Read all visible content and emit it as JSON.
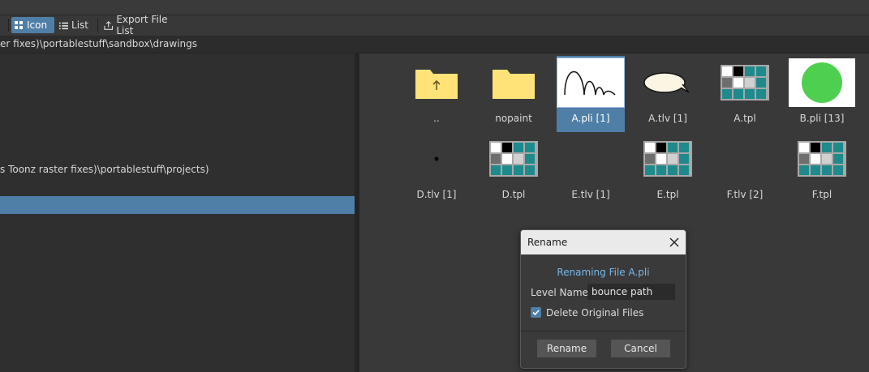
{
  "toolbar": {
    "icon_view_label": "Icon",
    "list_view_label": "List",
    "export_label": "Export File List"
  },
  "pathbar": {
    "path": "er fixes)\\portablestuff\\sandbox\\drawings"
  },
  "tree": {
    "project_path": "s Toonz raster fixes)\\portablestuff\\projects)"
  },
  "files": [
    {
      "label": "..",
      "kind": "folder-up",
      "selected": false
    },
    {
      "label": "nopaint",
      "kind": "folder",
      "selected": false
    },
    {
      "label": "A.pli [1]",
      "kind": "vector-curve",
      "selected": true
    },
    {
      "label": "A.tlv [1]",
      "kind": "speech-bubble",
      "selected": false
    },
    {
      "label": "A.tpl",
      "kind": "palette",
      "selected": false
    },
    {
      "label": "B.pli [13]",
      "kind": "green-circle",
      "selected": false
    },
    {
      "label": "D.tlv [1]",
      "kind": "dot",
      "selected": false
    },
    {
      "label": "D.tpl",
      "kind": "palette",
      "selected": false
    },
    {
      "label": "E.tlv [1]",
      "kind": "empty",
      "selected": false
    },
    {
      "label": "E.tpl",
      "kind": "palette",
      "selected": false
    },
    {
      "label": "F.tlv [2]",
      "kind": "empty",
      "selected": false
    },
    {
      "label": "F.tpl",
      "kind": "palette",
      "selected": false
    }
  ],
  "dialog": {
    "title": "Rename",
    "heading": "Renaming File A.pli",
    "level_name_label": "Level Name:",
    "level_name_value": "bounce path",
    "delete_original_label": "Delete Original Files",
    "delete_original_checked": true,
    "rename_button": "Rename",
    "cancel_button": "Cancel"
  },
  "colors": {
    "accent": "#4f7ea6",
    "folder": "#ffe278",
    "palette_teal": "#1f8a8c",
    "palette_gray": "#a8a8a8",
    "green_circle": "#4fcf4f",
    "dialog_heading": "#79b8e8"
  }
}
